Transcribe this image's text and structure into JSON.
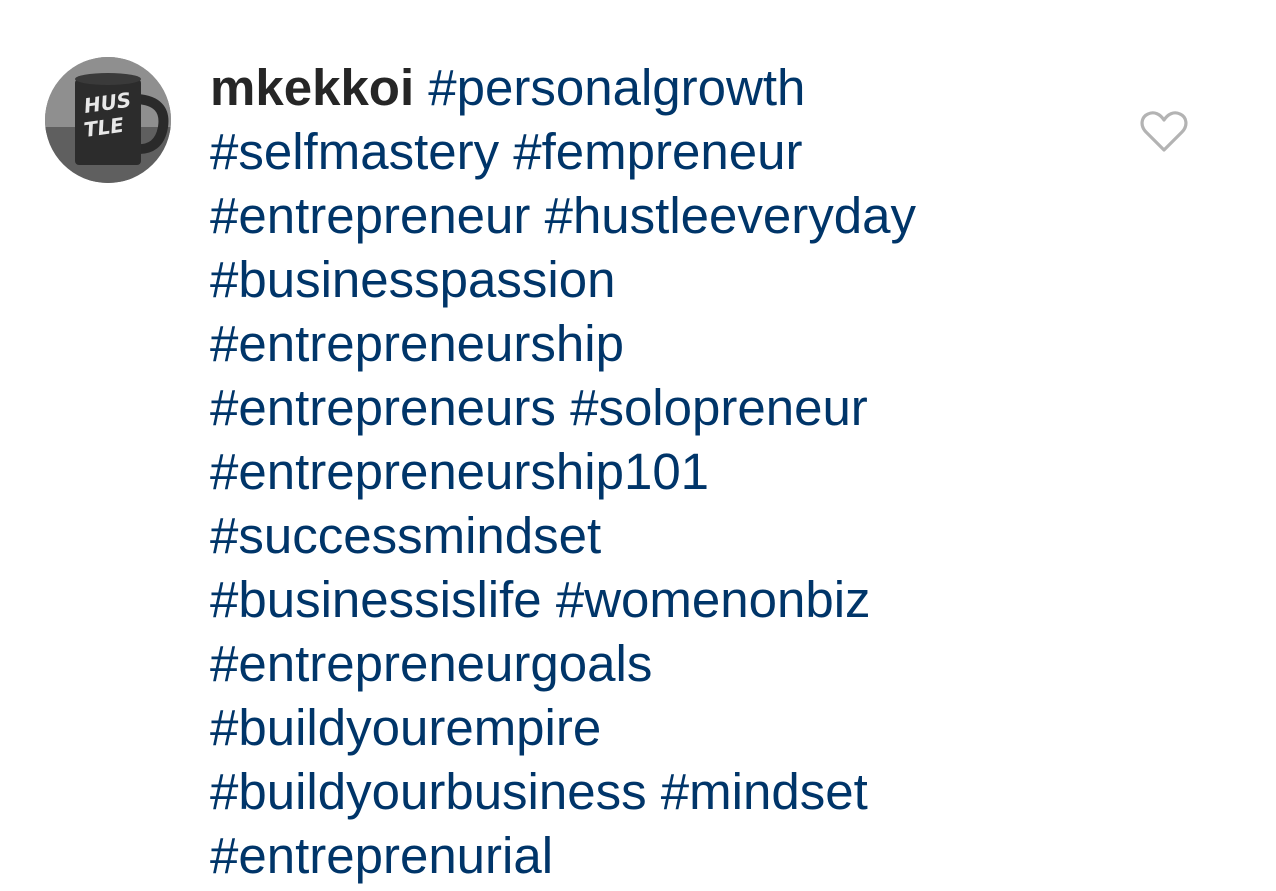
{
  "comment": {
    "username": "mkekkoi",
    "avatar": {
      "icon": "hustle-mug-avatar",
      "mug_text": [
        "HUS",
        "TLE"
      ]
    },
    "hashtag_lines": [
      [
        "#personalgrowth"
      ],
      [
        "#selfmastery",
        "#fempreneur"
      ],
      [
        "#entrepreneur",
        "#hustleeveryday"
      ],
      [
        "#businesspassion"
      ],
      [
        "#entrepreneurship"
      ],
      [
        "#entrepreneurs",
        "#solopreneur"
      ],
      [
        "#entrepreneurship101"
      ],
      [
        "#successmindset"
      ],
      [
        "#businessislife",
        "#womenonbiz"
      ],
      [
        "#entrepreneurgoals"
      ],
      [
        "#buildyourempire"
      ],
      [
        "#buildyourbusiness",
        "#mindset"
      ],
      [
        "#entreprenurial"
      ]
    ],
    "like_icon": "heart-outline-icon"
  },
  "colors": {
    "username": "#262626",
    "hashtag": "#003569",
    "heart": "#b3b3b3",
    "background": "#ffffff"
  }
}
